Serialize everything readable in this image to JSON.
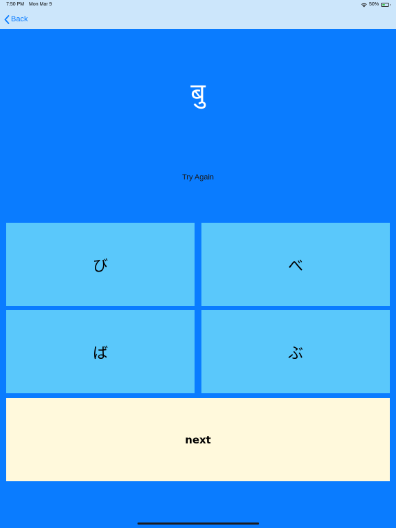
{
  "status_bar": {
    "time": "7:50 PM",
    "date": "Mon Mar 9",
    "battery_text": "50%",
    "battery_level": 0.5,
    "wifi_icon": "wifi-icon",
    "battery_icon": "battery-icon"
  },
  "nav": {
    "back_label": "Back",
    "back_icon": "chevron-left-icon"
  },
  "question": {
    "character": "बु"
  },
  "feedback": {
    "text": "Try Again"
  },
  "answers": [
    {
      "label": "び"
    },
    {
      "label": "べ"
    },
    {
      "label": "ば"
    },
    {
      "label": "ぶ"
    }
  ],
  "next_label": "next",
  "colors": {
    "background": "#0a7cff",
    "nav_background": "#cce6fb",
    "answer_button": "#5ac8fb",
    "next_button": "#fff9dc",
    "accent": "#0a7cff"
  }
}
